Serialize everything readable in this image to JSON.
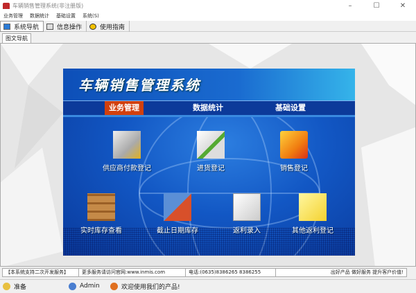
{
  "window": {
    "title": "车辆销售管理系统(非注册版)",
    "minimize": "–",
    "maximize": "☐",
    "close": "✕"
  },
  "menu": [
    "业务管理",
    "数据统计",
    "基础设置",
    "系统(S)"
  ],
  "toolbar": [
    {
      "label": "系统导航",
      "icon": "nav-icon"
    },
    {
      "label": "信息操作",
      "icon": "info-icon"
    },
    {
      "label": "使用指南",
      "icon": "help-icon"
    }
  ],
  "tab": "图文导航",
  "panel": {
    "title": "车辆销售管理系统",
    "nav": [
      "业务管理",
      "数据统计",
      "基础设置"
    ],
    "items": [
      "供应商付款登记",
      "进货登记",
      "销售登记",
      "实时库存查看",
      "截止日期库存",
      "返利录入",
      "其他返利登记"
    ]
  },
  "info": [
    "【本系统支持二次开发服务】",
    "更多服务请访问官网:www.inmis.com",
    "电话:(0635)8386265 8386255",
    "出好产品 做好服务 提升客户价值!"
  ],
  "status": [
    "准备",
    "Admin",
    "欢迎使用我们的产品!"
  ],
  "colors": {
    "accent": "#d2400e",
    "panel": "#1257c4"
  }
}
